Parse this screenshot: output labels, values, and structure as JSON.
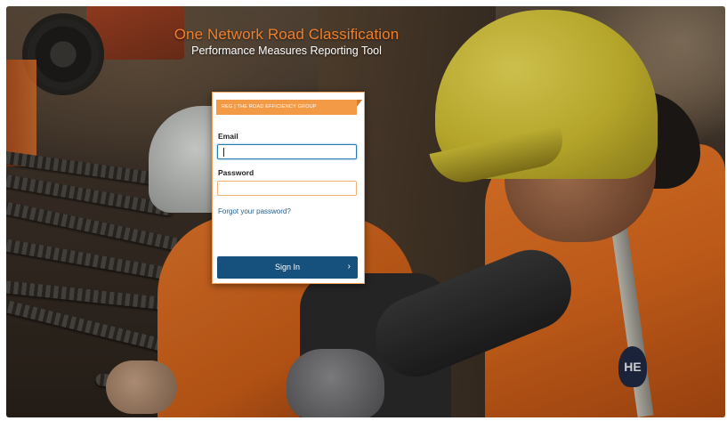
{
  "header": {
    "title": "One Network Road Classification",
    "subtitle": "Performance Measures Reporting Tool"
  },
  "login": {
    "brand_banner": "REG  |  THE ROAD EFFICIENCY GROUP",
    "email_label": "Email",
    "email_value": "",
    "password_label": "Password",
    "password_value": "",
    "forgot_link": "Forgot your password?",
    "signin_label": "Sign In",
    "signin_icon": "chevron-right-icon"
  },
  "background": {
    "vest_logo": "HE"
  },
  "colors": {
    "accent_orange": "#f07f2b",
    "banner_orange": "#f39a47",
    "button_blue": "#16507d",
    "link_blue": "#1f5e93"
  }
}
